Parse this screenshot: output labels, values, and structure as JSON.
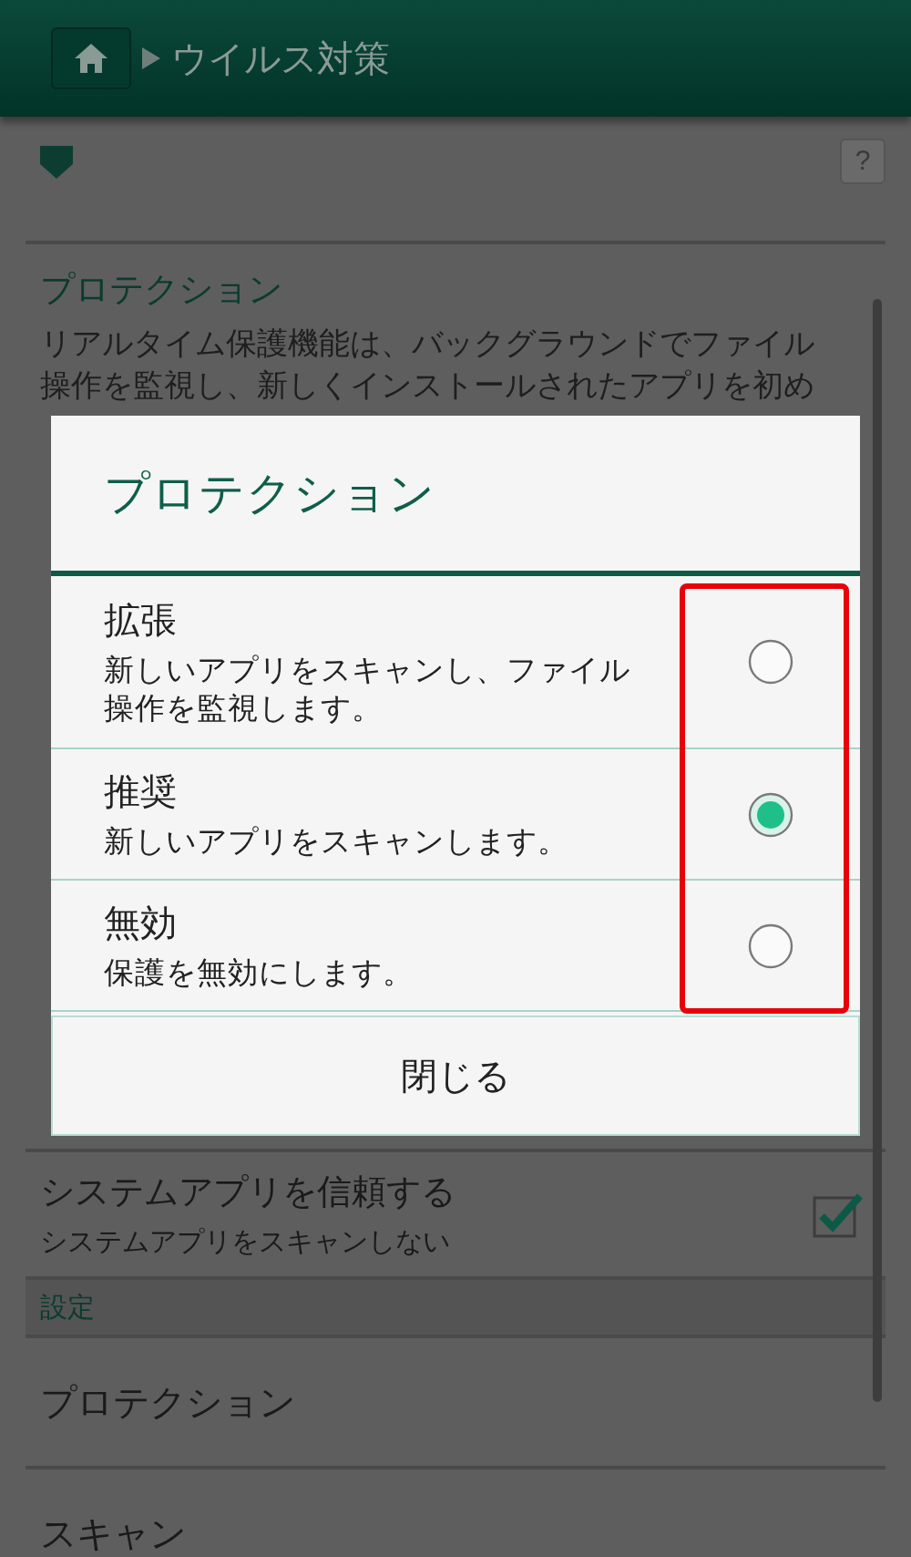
{
  "header": {
    "breadcrumb": "ウイルス対策"
  },
  "help_button": "?",
  "protection_section": {
    "title": "プロテクション",
    "description": "リアルタイム保護機能は、バックグラウンドでファイル操作を監視し、新しくインストールされたアプリを初め"
  },
  "trust_row": {
    "title": "システムアプリを信頼する",
    "subtitle": "システムアプリをスキャンしない",
    "checked": true
  },
  "settings": {
    "header": "設定",
    "items": [
      "プロテクション",
      "スキャン"
    ]
  },
  "dialog": {
    "title": "プロテクション",
    "options": [
      {
        "label": "拡張",
        "description": "新しいアプリをスキャンし、ファイル操作を監視します。",
        "selected": false
      },
      {
        "label": "推奨",
        "description": "新しいアプリをスキャンします。",
        "selected": true
      },
      {
        "label": "無効",
        "description": "保護を無効にします。",
        "selected": false
      }
    ],
    "close_button": "閉じる"
  }
}
